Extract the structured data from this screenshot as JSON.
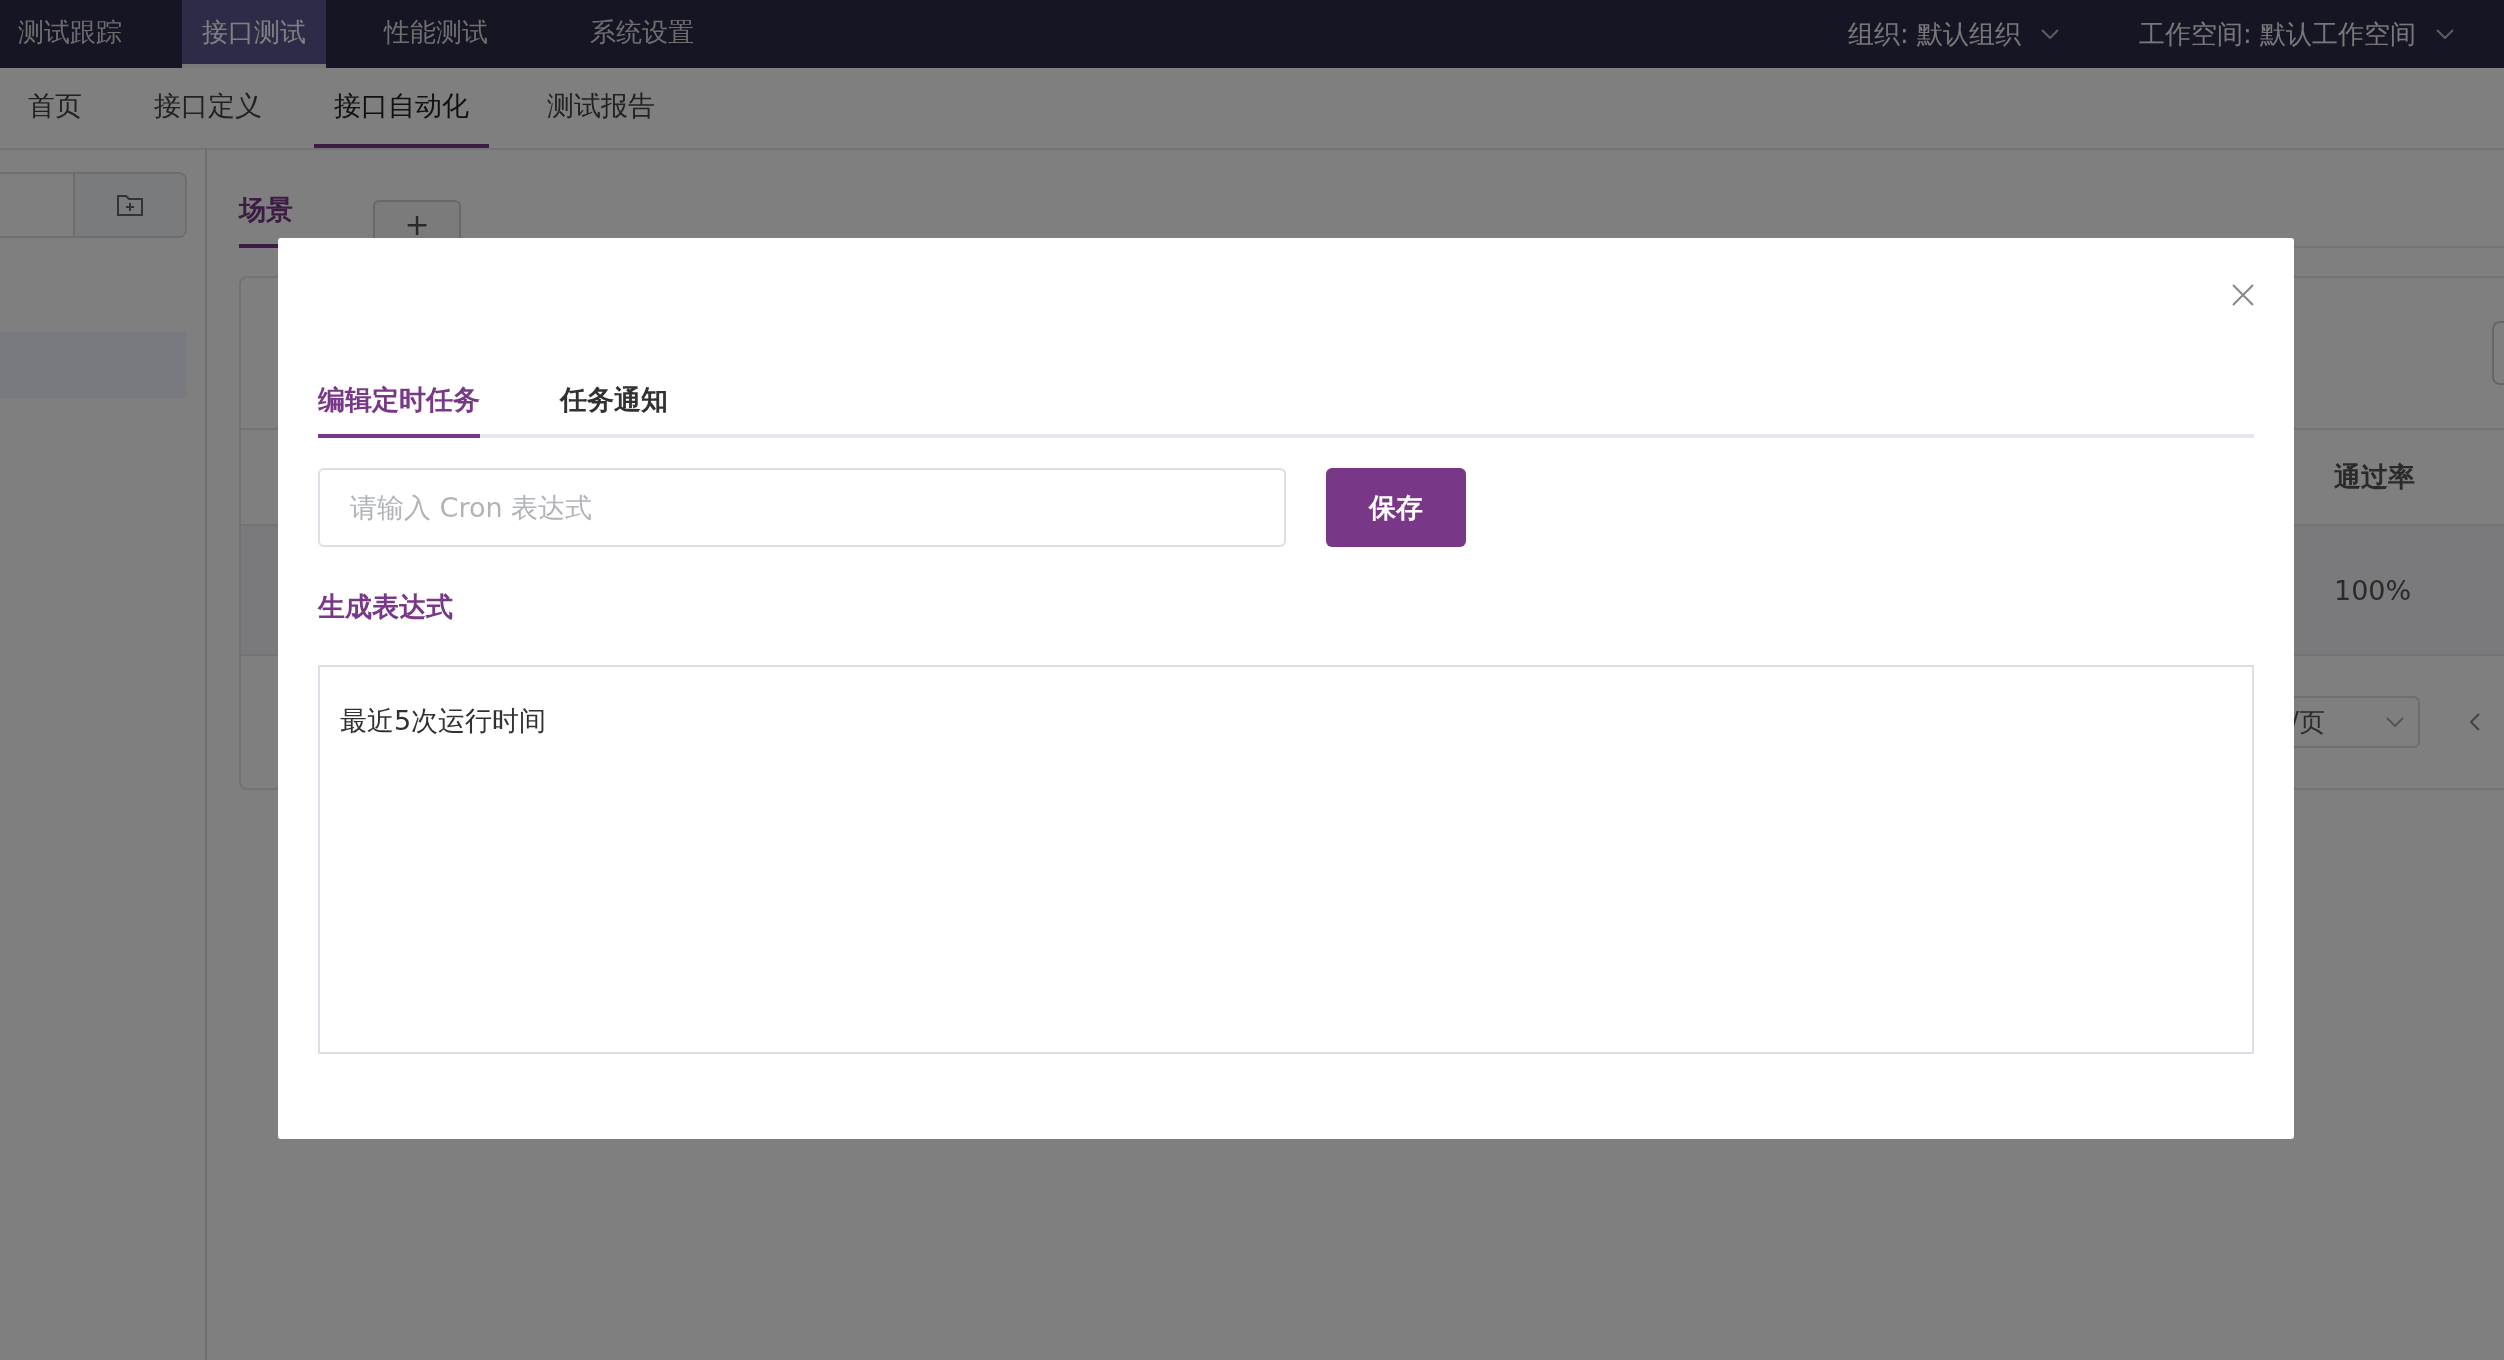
{
  "top_nav": {
    "tabs": [
      {
        "label": "测试跟踪",
        "selected": false
      },
      {
        "label": "接口测试",
        "selected": true
      },
      {
        "label": "性能测试",
        "selected": false
      },
      {
        "label": "系统设置",
        "selected": false
      }
    ],
    "organization": "组织: 默认组织",
    "workspace": "工作空间: 默认工作空间"
  },
  "sub_nav": [
    {
      "label": "首页",
      "selected": false
    },
    {
      "label": "接口定义",
      "selected": false
    },
    {
      "label": "接口自动化",
      "selected": true
    },
    {
      "label": "测试报告",
      "selected": false
    }
  ],
  "scenario_tab": "场景",
  "add_tab": "+",
  "table": {
    "column": "通过率",
    "row": "100%"
  },
  "pager": {
    "page_size": "/页"
  },
  "dialog": {
    "tabs": [
      {
        "label": "编辑定时任务",
        "selected": true
      },
      {
        "label": "任务通知",
        "selected": false
      }
    ],
    "cron_input": {
      "placeholder": "请输入 Cron 表达式"
    },
    "save": "保存",
    "generate_link": "生成表达式",
    "preview_title": "最近5次运行时间"
  }
}
